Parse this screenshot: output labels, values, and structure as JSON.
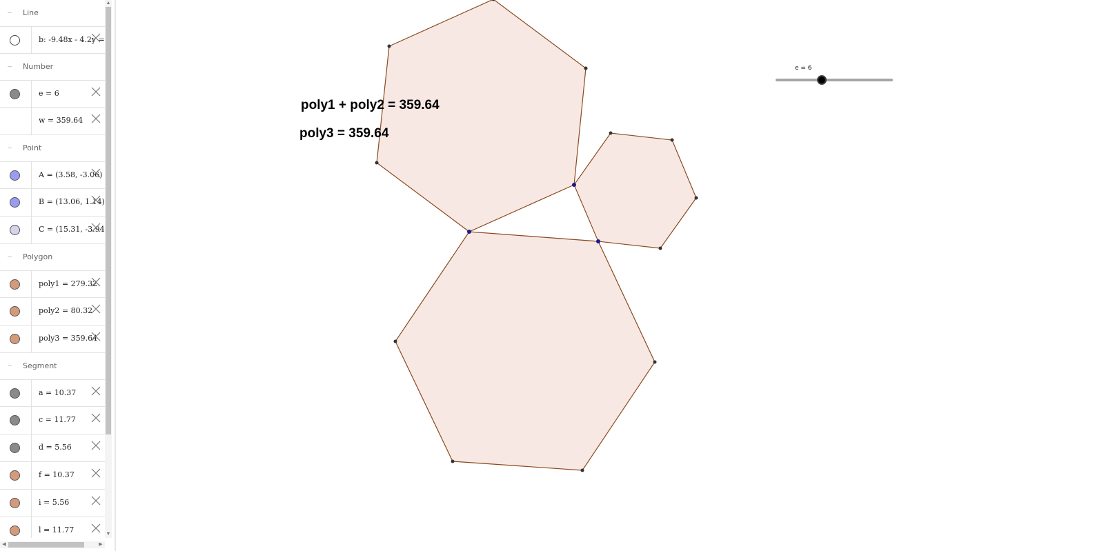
{
  "algebra": {
    "groups": [
      {
        "title": "Line",
        "rows": [
          {
            "label": "b: -9.48x - 4.2y = -",
            "marble": "hollow"
          }
        ]
      },
      {
        "title": "Number",
        "rows": [
          {
            "label": "e = 6",
            "marble": "#8a8a8a"
          },
          {
            "label": "w = 359.64",
            "marble": "none"
          }
        ]
      },
      {
        "title": "Point",
        "rows": [
          {
            "label": "A = (3.58, -3.06)",
            "marble": "#9a9cf2"
          },
          {
            "label": "B = (13.06, 1.14)",
            "marble": "#9a9cf2"
          },
          {
            "label": "C = (15.31, -3.94)",
            "marble": "#d4d4ea"
          }
        ]
      },
      {
        "title": "Polygon",
        "rows": [
          {
            "label": "poly1 = 279.32",
            "marble": "#d49a7c"
          },
          {
            "label": "poly2 = 80.32",
            "marble": "#d49a7c"
          },
          {
            "label": "poly3 = 359.64",
            "marble": "#d49a7c"
          }
        ]
      },
      {
        "title": "Segment",
        "rows": [
          {
            "label": "a = 10.37",
            "marble": "#8a8a8a"
          },
          {
            "label": "c = 11.77",
            "marble": "#8a8a8a"
          },
          {
            "label": "d = 5.56",
            "marble": "#8a8a8a"
          },
          {
            "label": "f = 10.37",
            "marble": "#d49a7c"
          },
          {
            "label": "i = 5.56",
            "marble": "#d49a7c"
          },
          {
            "label": "l = 11.77",
            "marble": "#d49a7c"
          }
        ]
      }
    ]
  },
  "graphics": {
    "text1": "poly1 + poly2 = 359.64",
    "text2": "poly3 = 359.64",
    "slider": {
      "label": "e = 6",
      "value": 6
    },
    "colors": {
      "fill": "#f7e8e4",
      "stroke": "#8b4a1e",
      "point": "#333333",
      "highlight_point": "#1a1a8c"
    }
  }
}
